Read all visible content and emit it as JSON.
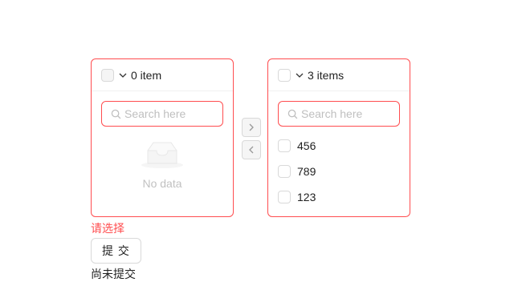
{
  "left_panel": {
    "count_label": "0 item",
    "search_placeholder": "Search here",
    "empty_text": "No data"
  },
  "right_panel": {
    "count_label": "3 items",
    "search_placeholder": "Search here",
    "items": [
      "456",
      "789",
      "123"
    ]
  },
  "operations": {
    "to_right_icon": "right-arrow",
    "to_left_icon": "left-arrow"
  },
  "form": {
    "error_message": "请选择",
    "submit_label": "提 交",
    "status_text": "尚未提交"
  },
  "colors": {
    "error": "#ff4d4f",
    "border": "#d9d9d9",
    "disabled_bg": "#f5f5f5"
  }
}
